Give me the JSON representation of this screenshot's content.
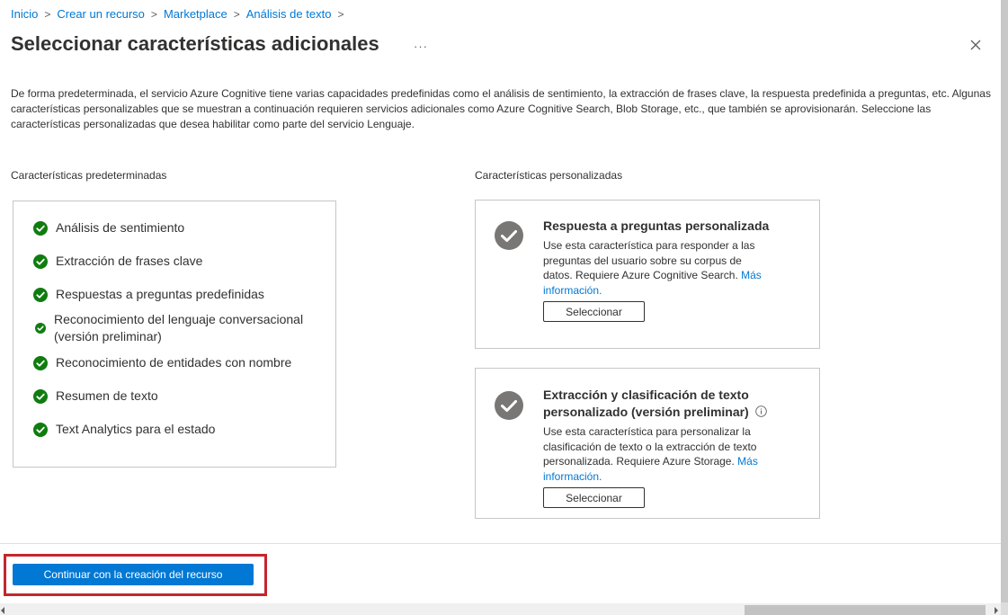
{
  "breadcrumb": {
    "items": [
      "Inicio",
      "Crear un recurso",
      "Marketplace",
      "Análisis de texto"
    ],
    "separator": ">"
  },
  "header": {
    "title": "Seleccionar características adicionales",
    "more_label": "···"
  },
  "description": "De forma predeterminada, el servicio Azure Cognitive tiene varias capacidades predefinidas como el análisis de sentimiento, la extracción de frases clave, la respuesta predefinida a preguntas, etc. Algunas características personalizables que se muestran a continuación requieren servicios adicionales como Azure Cognitive Search, Blob Storage, etc., que también se aprovisionarán. Seleccione las características personalizadas que desea habilitar como parte del servicio Lenguaje.",
  "default_features": {
    "heading": "Características predeterminadas",
    "items": [
      "Análisis de sentimiento",
      "Extracción de frases clave",
      "Respuestas a preguntas predefinidas",
      "Reconocimiento del lenguaje conversacional",
      "(versión preliminar)",
      "Reconocimiento de entidades con nombre",
      "Resumen de texto",
      "Text Analytics para el estado"
    ]
  },
  "custom_features": {
    "heading": "Características personalizadas",
    "cards": [
      {
        "title": "Respuesta a preguntas personalizada",
        "desc_lines": [
          "Use esta característica para responder a las",
          "preguntas del usuario sobre su corpus de",
          "datos. Requiere Azure Cognitive Search."
        ],
        "link_start": "Más",
        "link_end": "información.",
        "button": "Seleccionar"
      },
      {
        "title_line1": "Extracción y clasificación de texto",
        "title_line2": "personalizado (versión preliminar)",
        "desc_lines": [
          "Use esta característica para personalizar la",
          "clasificación de texto o la extracción de texto",
          "personalizada. Requiere Azure Storage."
        ],
        "link_start": "Más",
        "link_end": "información.",
        "button": "Seleccionar"
      }
    ]
  },
  "footer": {
    "primary_button": "Continuar con la creación del recurso"
  },
  "colors": {
    "accent": "#0078d4",
    "success": "#107c10",
    "card_check": "#797775",
    "highlight": "#c4262e"
  },
  "icons": {
    "check": "check-circle-icon",
    "info": "info-icon",
    "close": "close-icon"
  }
}
